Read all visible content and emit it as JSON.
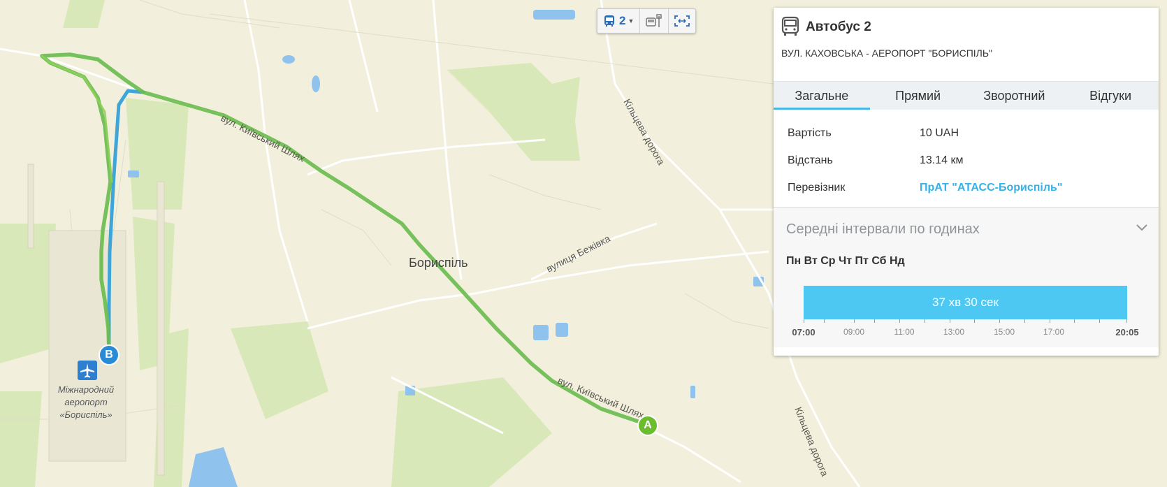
{
  "toolbar": {
    "route_number": "2",
    "colors": {
      "accent": "#2a6cb8"
    }
  },
  "panel": {
    "title": "Автобус 2",
    "route": "ВУЛ. КАХОВСЬКА - АЕРОПОРТ \"БОРИСПІЛЬ\"",
    "tabs": [
      {
        "label": "Загальне",
        "active": true
      },
      {
        "label": "Прямий",
        "active": false
      },
      {
        "label": "Зворотний",
        "active": false
      },
      {
        "label": "Відгуки",
        "active": false
      }
    ],
    "info": [
      {
        "key": "Вартість",
        "value": "10 UAH"
      },
      {
        "key": "Відстань",
        "value": "13.14 км"
      },
      {
        "key": "Перевізник",
        "value": "ПрАТ \"АТАСС-Бориспіль\""
      }
    ],
    "schedule": {
      "title": "Середні інтервали по годинах",
      "days": "Пн Вт Ср Чт Пт Сб Нд",
      "interval": "37 хв 30 сек",
      "axis_labels": [
        "07:00",
        "09:00",
        "11:00",
        "13:00",
        "15:00",
        "17:00",
        "20:05"
      ]
    }
  },
  "map": {
    "city": "Бориспіль",
    "airport": "Міжнародний аеропорт «Бориспіль»",
    "airport_lines": [
      "Міжнародний",
      "аеропорт «Бориспіль»"
    ],
    "streets": [
      "вул. Київський Шлях",
      "вул. Київський Шлях",
      "Кільцева дорога",
      "Кільцева дорога",
      "вулиця Бежівка"
    ],
    "markers": {
      "start": "A",
      "end": "B"
    },
    "colors": {
      "route_forward": "#6bbd4f",
      "route_back": "#3fa5d8",
      "background": "#f2f0dc"
    }
  }
}
